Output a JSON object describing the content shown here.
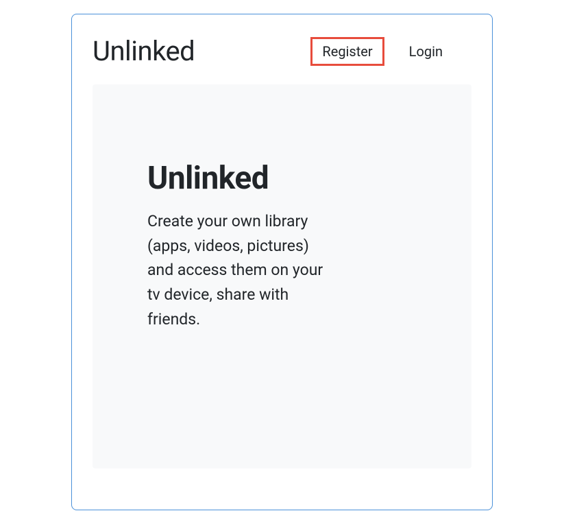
{
  "header": {
    "brand": "Unlinked",
    "nav": {
      "register": "Register",
      "login": "Login"
    }
  },
  "hero": {
    "title": "Unlinked",
    "description": "Create your own library (apps, videos, pictures) and access them on your tv device, share with friends."
  }
}
